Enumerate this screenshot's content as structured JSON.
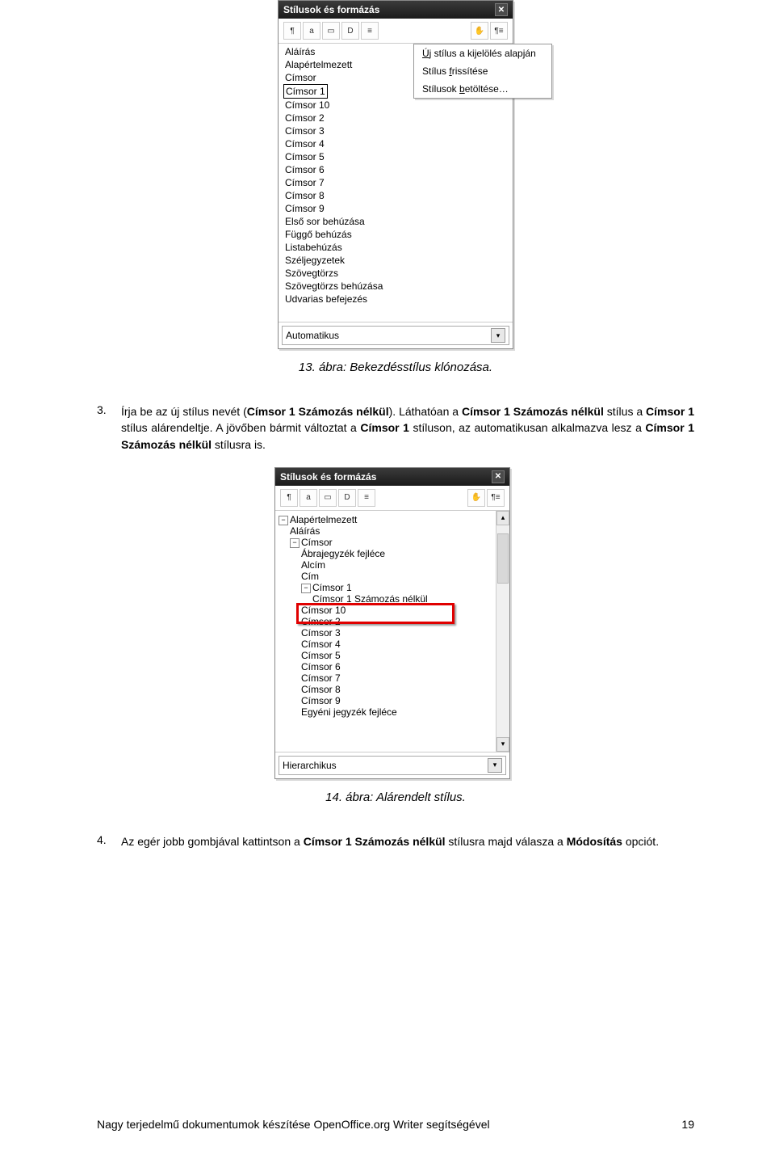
{
  "dialog1": {
    "title": "Stílusok és formázás",
    "icons": [
      "¶",
      "a",
      "▭",
      "D",
      "≡"
    ],
    "icons_right": [
      "✋",
      "¶≡"
    ],
    "styles": [
      "Aláírás",
      "Alapértelmezett",
      "Címsor",
      "Címsor 1",
      "Címsor 10",
      "Címsor 2",
      "Címsor 3",
      "Címsor 4",
      "Címsor 5",
      "Címsor 6",
      "Címsor 7",
      "Címsor 8",
      "Címsor 9",
      "Első sor behúzása",
      "Függő behúzás",
      "Listabehúzás",
      "Széljegyzetek",
      "Szövegtörzs",
      "Szövegtörzs behúzása",
      "Udvarias befejezés"
    ],
    "selected_index": 3,
    "filter": "Automatikus"
  },
  "context_menu": {
    "items": [
      {
        "pre": "",
        "u": "Ú",
        "post": "j stílus a kijelölés alapján"
      },
      {
        "pre": "Stílus ",
        "u": "f",
        "post": "rissítése"
      },
      {
        "pre": "Stílusok ",
        "u": "b",
        "post": "etöltése…"
      }
    ]
  },
  "caption1": "13. ábra: Bekezdésstílus klónozása.",
  "para3": {
    "num": "3.",
    "text_parts": {
      "p1": "Írja be az új stílus nevét (",
      "b1": "Címsor 1 Számozás nélkül",
      "p2": "). Láthatóan a ",
      "b2": "Címsor 1 Számozás nélkül",
      "p3": " stílus a ",
      "b3": "Címsor 1",
      "p4": " stílus alárendeltje. A jövőben bármit változtat a ",
      "b4": "Címsor 1",
      "p5": " stíluson, az automatikusan alkalmazva lesz a ",
      "b5": "Címsor 1 Számozás nélkül",
      "p6": " stílusra is."
    }
  },
  "dialog2": {
    "title": "Stílusok és formázás",
    "icons": [
      "¶",
      "a",
      "▭",
      "D",
      "≡"
    ],
    "icons_right": [
      "✋",
      "¶≡"
    ],
    "tree": [
      {
        "indent": 0,
        "exp": "−",
        "label": "Alapértelmezett",
        "dashed": true
      },
      {
        "indent": 1,
        "exp": "",
        "label": "Aláírás"
      },
      {
        "indent": 1,
        "exp": "−",
        "label": "Címsor"
      },
      {
        "indent": 2,
        "exp": "",
        "label": "Ábrajegyzék fejléce"
      },
      {
        "indent": 2,
        "exp": "",
        "label": "Alcím"
      },
      {
        "indent": 2,
        "exp": "",
        "label": "Cím"
      },
      {
        "indent": 2,
        "exp": "−",
        "label": "Címsor 1"
      },
      {
        "indent": 3,
        "exp": "",
        "label": "Címsor 1 Számozás nélkül",
        "highlight": true
      },
      {
        "indent": 2,
        "exp": "",
        "label": "Címsor 10"
      },
      {
        "indent": 2,
        "exp": "",
        "label": "Címsor 2"
      },
      {
        "indent": 2,
        "exp": "",
        "label": "Címsor 3"
      },
      {
        "indent": 2,
        "exp": "",
        "label": "Címsor 4"
      },
      {
        "indent": 2,
        "exp": "",
        "label": "Címsor 5"
      },
      {
        "indent": 2,
        "exp": "",
        "label": "Címsor 6"
      },
      {
        "indent": 2,
        "exp": "",
        "label": "Címsor 7"
      },
      {
        "indent": 2,
        "exp": "",
        "label": "Címsor 8"
      },
      {
        "indent": 2,
        "exp": "",
        "label": "Címsor 9"
      },
      {
        "indent": 2,
        "exp": "",
        "label": "Egyéni jegyzék fejléce"
      }
    ],
    "filter": "Hierarchikus"
  },
  "caption2": "14. ábra: Alárendelt stílus.",
  "para4": {
    "num": "4.",
    "text_parts": {
      "p1": "Az egér jobb gombjával kattintson a ",
      "b1": "Címsor 1 Számozás nélkül",
      "p2": " stílusra majd válasza a ",
      "b2": "Módosítás",
      "p3": " opciót."
    }
  },
  "footer": {
    "left": "Nagy terjedelmű dokumentumok készítése OpenOffice.org Writer segítségével",
    "right": "19"
  }
}
